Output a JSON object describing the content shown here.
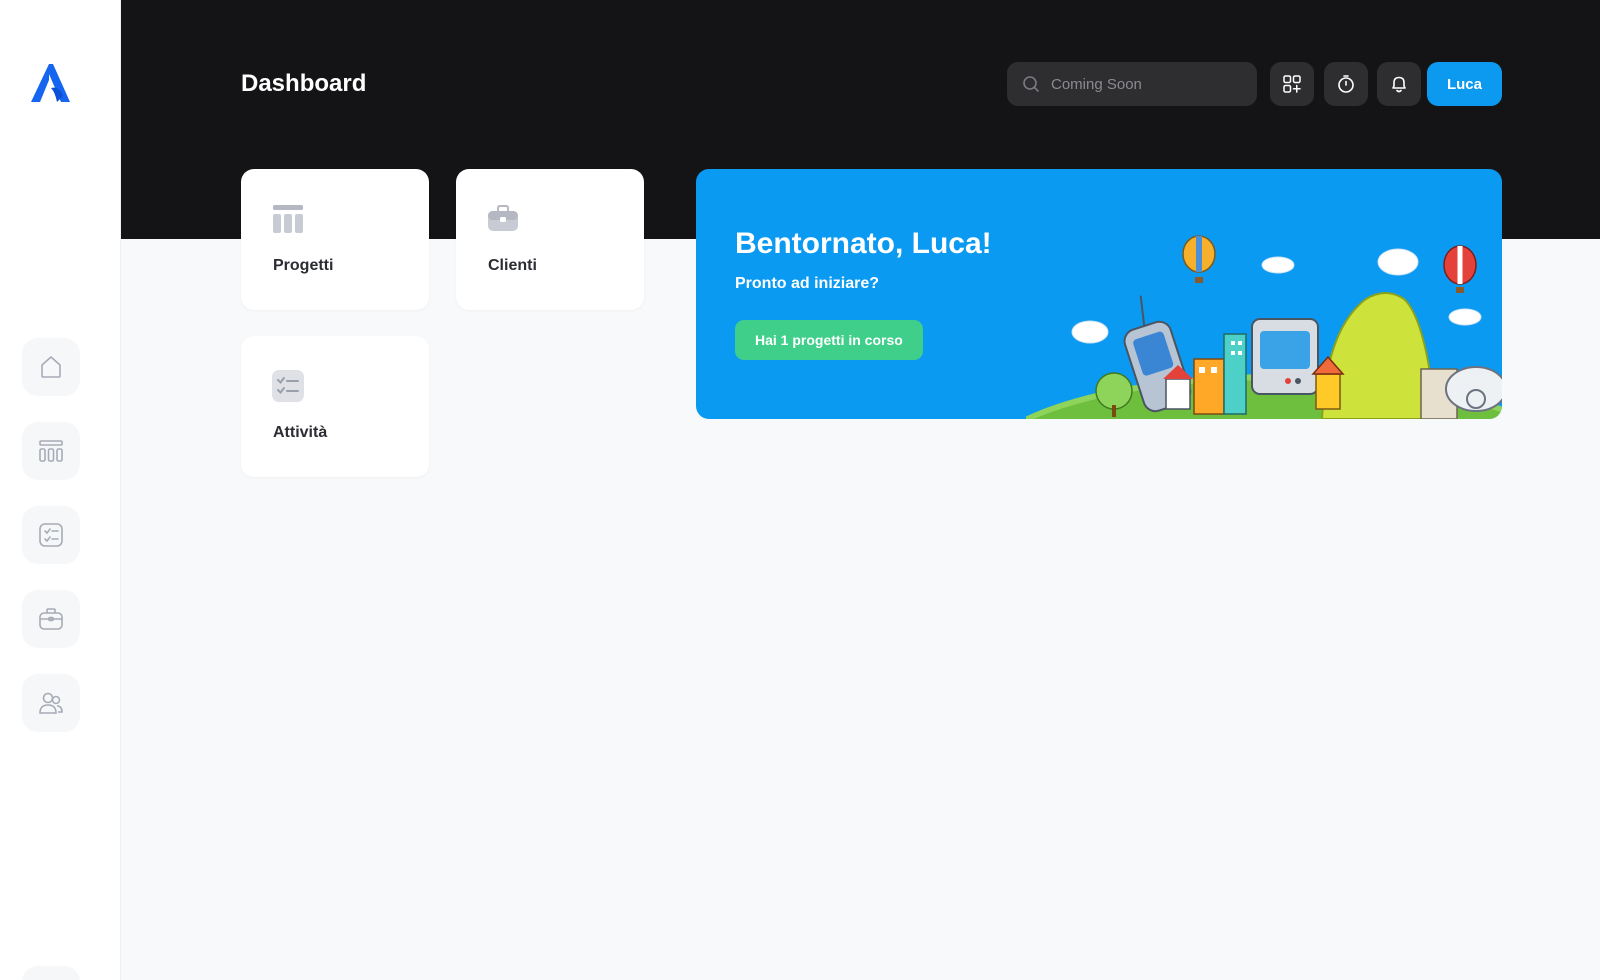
{
  "header": {
    "title": "Dashboard",
    "search_placeholder": "Coming Soon",
    "user_label": "Luca",
    "icons": [
      "search-icon",
      "add-widget-icon",
      "timer-icon",
      "bell-icon"
    ]
  },
  "sidebar": {
    "items": [
      {
        "name": "home",
        "icon": "home-icon"
      },
      {
        "name": "projects",
        "icon": "columns-icon"
      },
      {
        "name": "tasks",
        "icon": "checklist-icon"
      },
      {
        "name": "clients",
        "icon": "briefcase-icon"
      },
      {
        "name": "team",
        "icon": "users-icon"
      }
    ]
  },
  "cards": [
    {
      "label": "Progetti",
      "icon": "projects-icon"
    },
    {
      "label": "Clienti",
      "icon": "briefcase-icon"
    },
    {
      "label": "Attività",
      "icon": "checklist-icon"
    }
  ],
  "banner": {
    "title": "Bentornato, Luca!",
    "subtitle": "Pronto ad iniziare?",
    "cta": "Hai 1 progetti in corso"
  },
  "colors": {
    "accent": "#0b9aef",
    "header_bg": "#141416",
    "banner_bg": "#0a9af2",
    "cta_bg": "#3fcf8a",
    "page_bg": "#f8f9fb",
    "logo": "#1565f0"
  }
}
